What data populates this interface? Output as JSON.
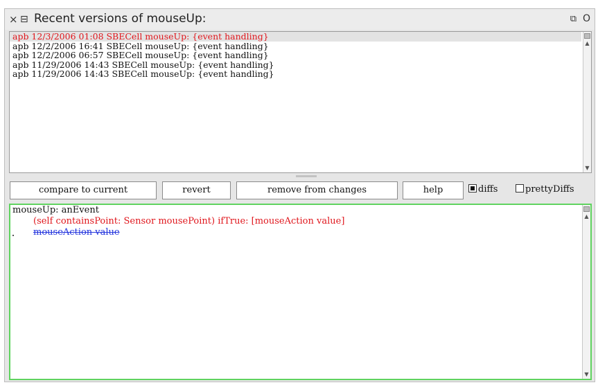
{
  "window": {
    "title": "Recent versions of mouseUp:",
    "close_glyph": "×",
    "menu_glyph": "⊟",
    "collapse_glyph": "⧉",
    "expand_glyph": "O"
  },
  "versions": [
    "apb 12/3/2006 01:08 SBECell mouseUp: {event handling}",
    "apb 12/2/2006 16:41 SBECell mouseUp: {event handling}",
    "apb 12/2/2006 06:57 SBECell mouseUp: {event handling}",
    "apb 11/29/2006 14:43 SBECell mouseUp: {event handling}",
    "apb 11/29/2006 14:43 SBECell mouseUp: {event handling}"
  ],
  "selected_index": 0,
  "buttons": {
    "compare": "compare to current",
    "revert": "revert",
    "remove": "remove from changes",
    "help": "help"
  },
  "checkboxes": {
    "diffs": "diffs",
    "pretty_diffs": "prettyDiffs"
  },
  "code": {
    "line1": "mouseUp: anEvent",
    "line2": "(self containsPoint: Sensor mousePoint)  ifTrue: [mouseAction value]",
    "line3": "mouseAction value"
  },
  "colors": {
    "selected_text": "#e0161c",
    "added_text": "#e0161c",
    "removed_text": "#2233dd",
    "code_pane_border": "#5fd35f"
  }
}
